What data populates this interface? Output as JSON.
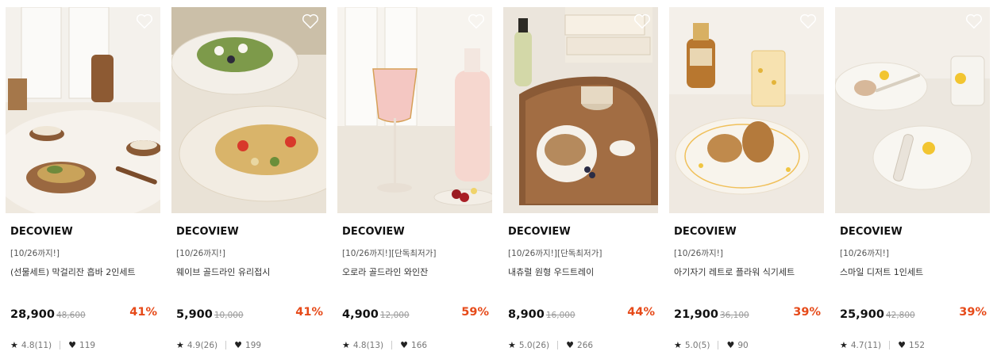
{
  "products": [
    {
      "brand": "DECOVIEW",
      "promo": "[10/26까지!]",
      "name": "(선물세트) 막걸리잔 흡바 2인세트",
      "price": "28,900",
      "original_price": "48,600",
      "discount": "41%",
      "rating": "4.8(11)",
      "likes": "119"
    },
    {
      "brand": "DECOVIEW",
      "promo": "[10/26까지!]",
      "name": "웨이브 골드라인 유리접시",
      "price": "5,900",
      "original_price": "10,000",
      "discount": "41%",
      "rating": "4.9(26)",
      "likes": "199"
    },
    {
      "brand": "DECOVIEW",
      "promo": "[10/26까지!][단독최저가]",
      "name": "오로라 골드라인 와인잔",
      "price": "4,900",
      "original_price": "12,000",
      "discount": "59%",
      "rating": "4.8(13)",
      "likes": "166"
    },
    {
      "brand": "DECOVIEW",
      "promo": "[10/26까지!][단독최저가]",
      "name": "내츄럴 원형 우드트레이",
      "price": "8,900",
      "original_price": "16,000",
      "discount": "44%",
      "rating": "5.0(26)",
      "likes": "266"
    },
    {
      "brand": "DECOVIEW",
      "promo": "[10/26까지!]",
      "name": "아기자기 레트로 플라워 식기세트",
      "price": "21,900",
      "original_price": "36,100",
      "discount": "39%",
      "rating": "5.0(5)",
      "likes": "90"
    },
    {
      "brand": "DECOVIEW",
      "promo": "[10/26까지!]",
      "name": "스마일 디저트 1인세트",
      "price": "25,900",
      "original_price": "42,800",
      "discount": "39%",
      "rating": "4.7(11)",
      "likes": "152"
    }
  ],
  "icons": {
    "wishlist": "heart-outline-icon",
    "rating": "star-icon",
    "likes": "heart-filled-icon"
  },
  "colors": {
    "discount": "#e64a19",
    "brand_text": "#111111",
    "muted": "#777777"
  }
}
